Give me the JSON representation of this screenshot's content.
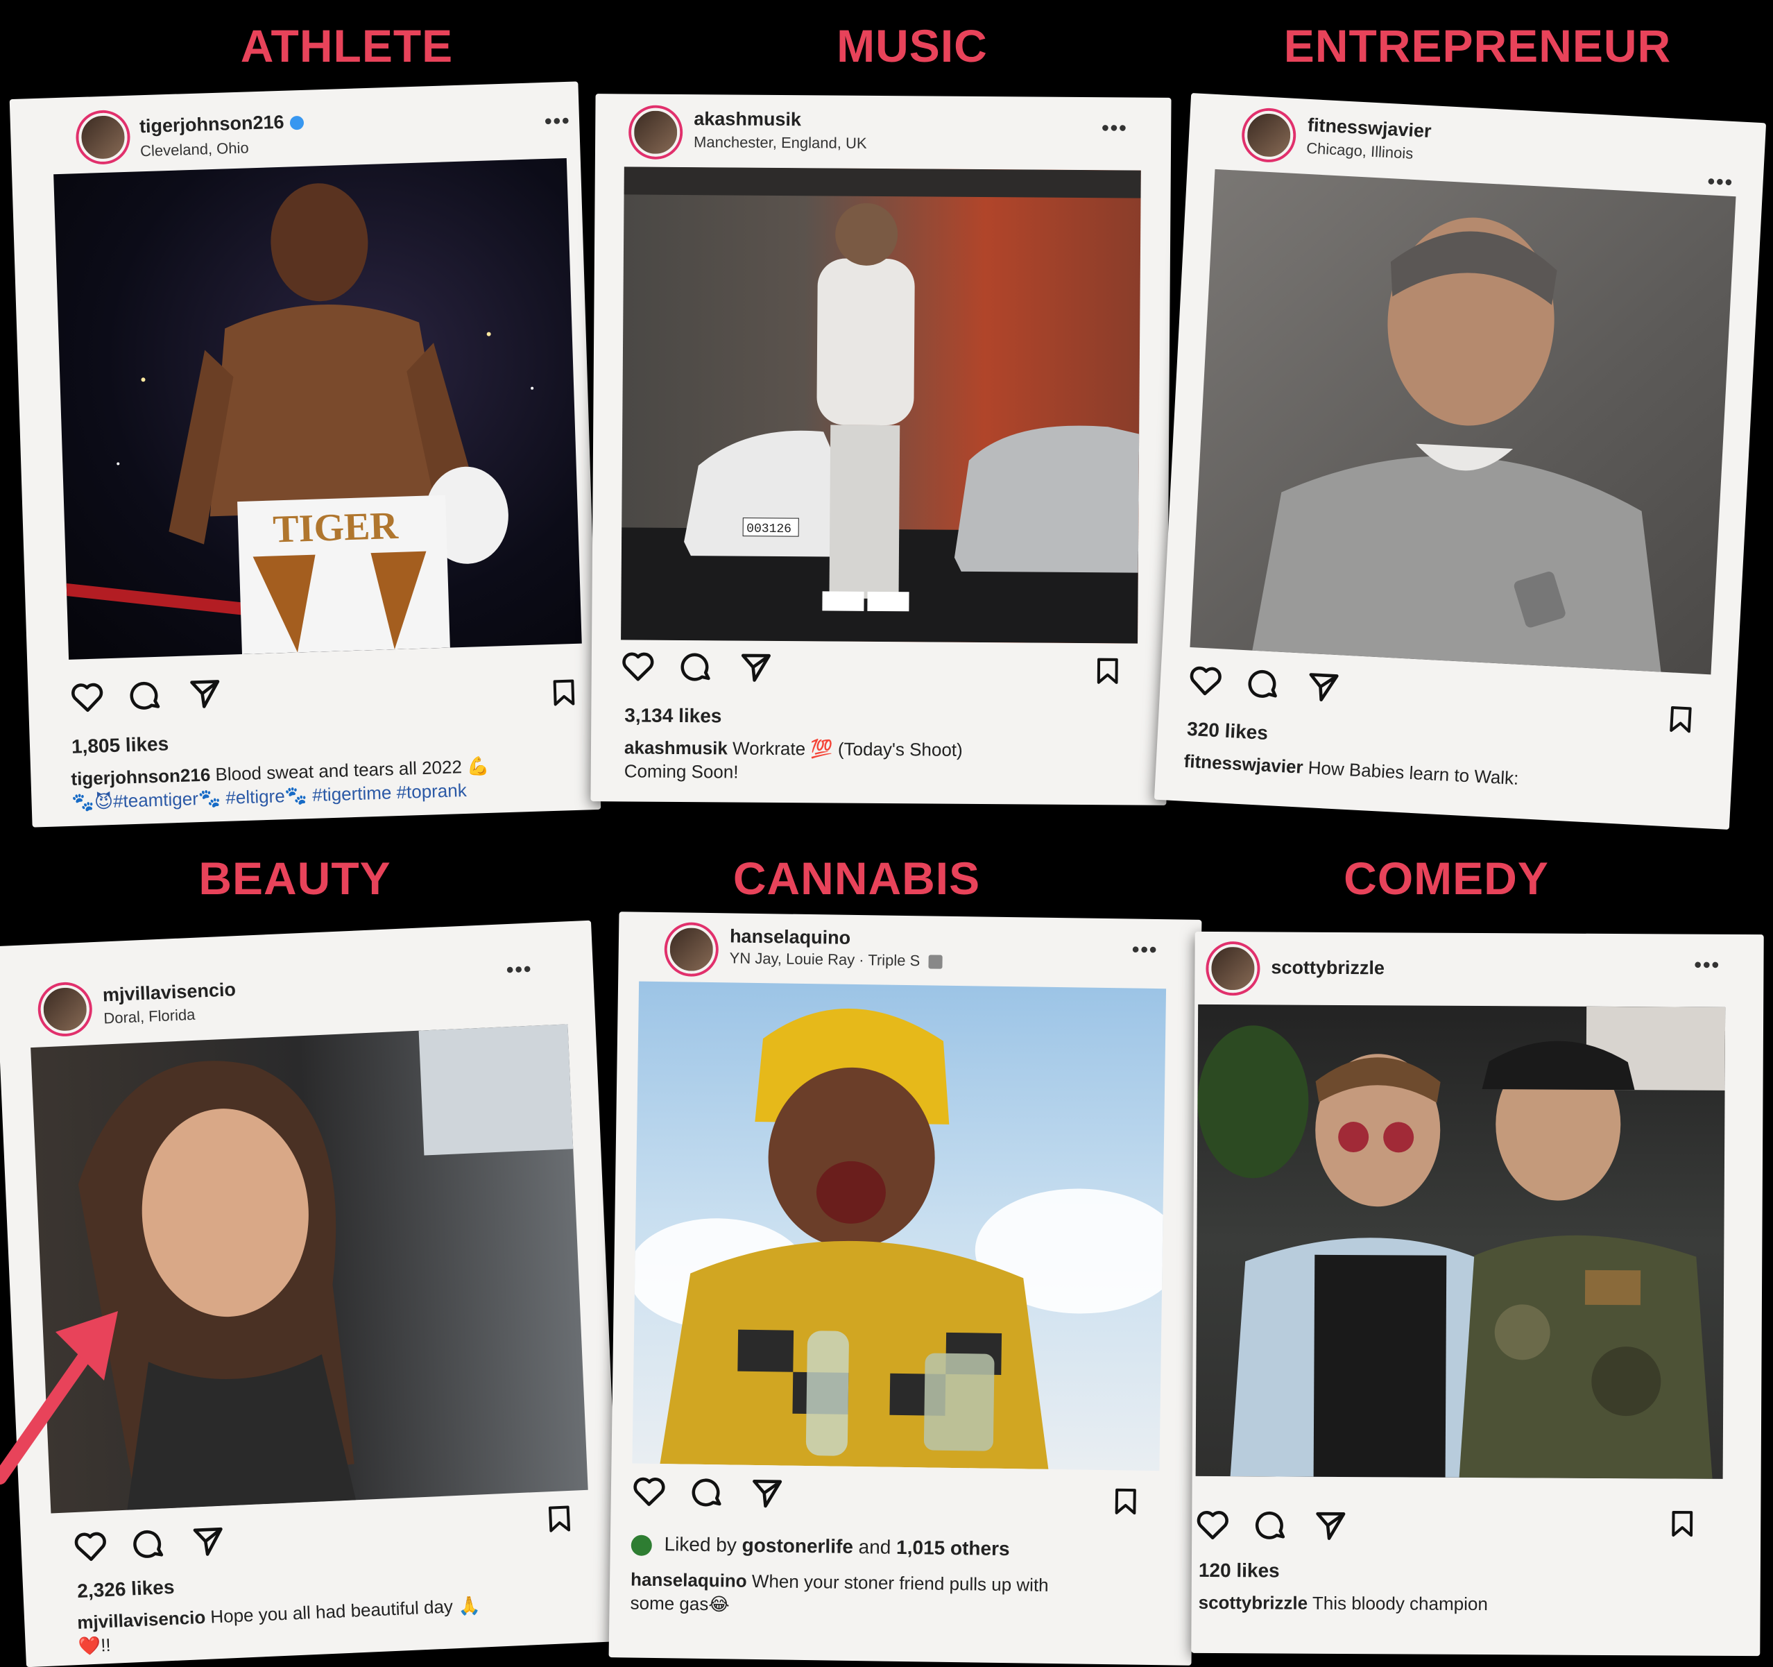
{
  "categories": [
    "ATHLETE",
    "MUSIC",
    "ENTREPRENEUR",
    "BEAUTY",
    "CANNABIS",
    "COMEDY"
  ],
  "colors": {
    "accent": "#e8435a",
    "hashtag": "#2b59a6",
    "card": "#f4f3f1"
  },
  "posts": [
    {
      "username": "tigerjohnson216",
      "location": "Cleveland, Ohio",
      "verified": true,
      "likes": "1,805 likes",
      "caption": "Blood sweat and tears all 2022 💪",
      "hashtags": "🐾😈#teamtiger🐾 #eltigre🐾 #tigertime #toprank",
      "photo_text": "TIGER"
    },
    {
      "username": "akashmusik",
      "location": "Manchester, England, UK",
      "likes": "3,134 likes",
      "caption": "Workrate 💯 (Today's Shoot)",
      "caption2": "Coming Soon!",
      "photo_text": "003126"
    },
    {
      "username": "fitnesswjavier",
      "location": "Chicago, Illinois",
      "likes": "320 likes",
      "caption": "How Babies learn to Walk:"
    },
    {
      "username": "mjvillavisencio",
      "location": "Doral, Florida",
      "likes": "2,326 likes",
      "caption": "Hope you all had beautiful day 🙏",
      "caption2": "❤️!!"
    },
    {
      "username": "hanselaquino",
      "location": "YN Jay, Louie Ray · Triple S",
      "liked_by_prefix": "Liked by",
      "liked_by_user": "gostonerlife",
      "liked_by_suffix": "and",
      "liked_by_others": "1,015 others",
      "caption": "When your stoner friend pulls up with",
      "caption2": "some gas😂"
    },
    {
      "username": "scottybrizzle",
      "likes": "120 likes",
      "caption": "This bloody champion"
    }
  ],
  "icons": [
    "heart-icon",
    "comment-icon",
    "share-icon",
    "bookmark-icon",
    "more-icon",
    "arrow-icon"
  ]
}
